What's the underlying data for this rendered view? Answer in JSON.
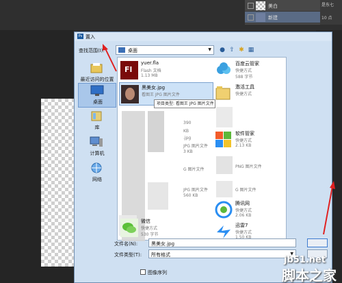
{
  "photoshop": {
    "layers": [
      {
        "name": "美白"
      },
      {
        "name": "新建"
      }
    ],
    "properties_text": [
      "是东七",
      "10 点"
    ]
  },
  "dialog": {
    "title": "置入",
    "icon_text": "Ps",
    "look_in_label": "查找范围(I):",
    "look_in_value": "桌面",
    "places": [
      {
        "label": "最近访问的位置",
        "icon": "recent-icon"
      },
      {
        "label": "桌面",
        "icon": "desktop-icon"
      },
      {
        "label": "库",
        "icon": "library-icon"
      },
      {
        "label": "计算机",
        "icon": "computer-icon"
      },
      {
        "label": "网络",
        "icon": "network-icon"
      }
    ],
    "files": [
      {
        "name": "yuer.fla",
        "type": "Flash 文档",
        "size": "1.13 MB",
        "icon": "flash-icon"
      },
      {
        "name": "黑美女.jpg",
        "type": "看图王 JPG 图片文件",
        "size": "",
        "icon": "photo-thumbnail"
      },
      {
        "name": "",
        "type": "",
        "size": "",
        "icon": "blurred-icon"
      },
      {
        "name": "百度云管家",
        "type": "快捷方式",
        "size": "588 字节",
        "icon": "baidu-cloud-icon"
      },
      {
        "name": "激活工具",
        "type": "快捷方式",
        "size": "",
        "icon": "folder-icon"
      },
      {
        "name": "软件管家",
        "type": "快捷方式",
        "size": "2.13 KB",
        "icon": "software-manager-icon"
      },
      {
        "name": "腾讯网",
        "type": "快捷方式",
        "size": "2.06 KB",
        "icon": "tencent-icon"
      },
      {
        "name": "微信",
        "type": "快捷方式",
        "size": "530 字节",
        "icon": "wechat-icon"
      },
      {
        "name": "迅雷7",
        "type": "快捷方式",
        "size": "1.50 KB",
        "icon": "xunlei-icon"
      }
    ],
    "partial_text": {
      "a": ".jpg",
      "b": "JPG 图片文件",
      "c": "3 KB",
      "d": "G 图片文件",
      "e": "JPG 图片文件",
      "f": "560 KB",
      "g": "PNG 图片文件",
      "h": "G 图片文件",
      "i": "390",
      "j": "KB",
      "k": "PNG 图片文件",
      "l": "G 图片文件"
    },
    "tooltip": "项目类型: 看图王 JPG 图片文件",
    "file_name_label": "文件名(N):",
    "file_name_value": "黑美女.jpg",
    "file_type_label": "文件类型(T):",
    "file_type_value": "所有格式",
    "image_sequence_label": "图像序列"
  },
  "watermark": {
    "site": "jb51.net",
    "name": "脚本之家"
  }
}
